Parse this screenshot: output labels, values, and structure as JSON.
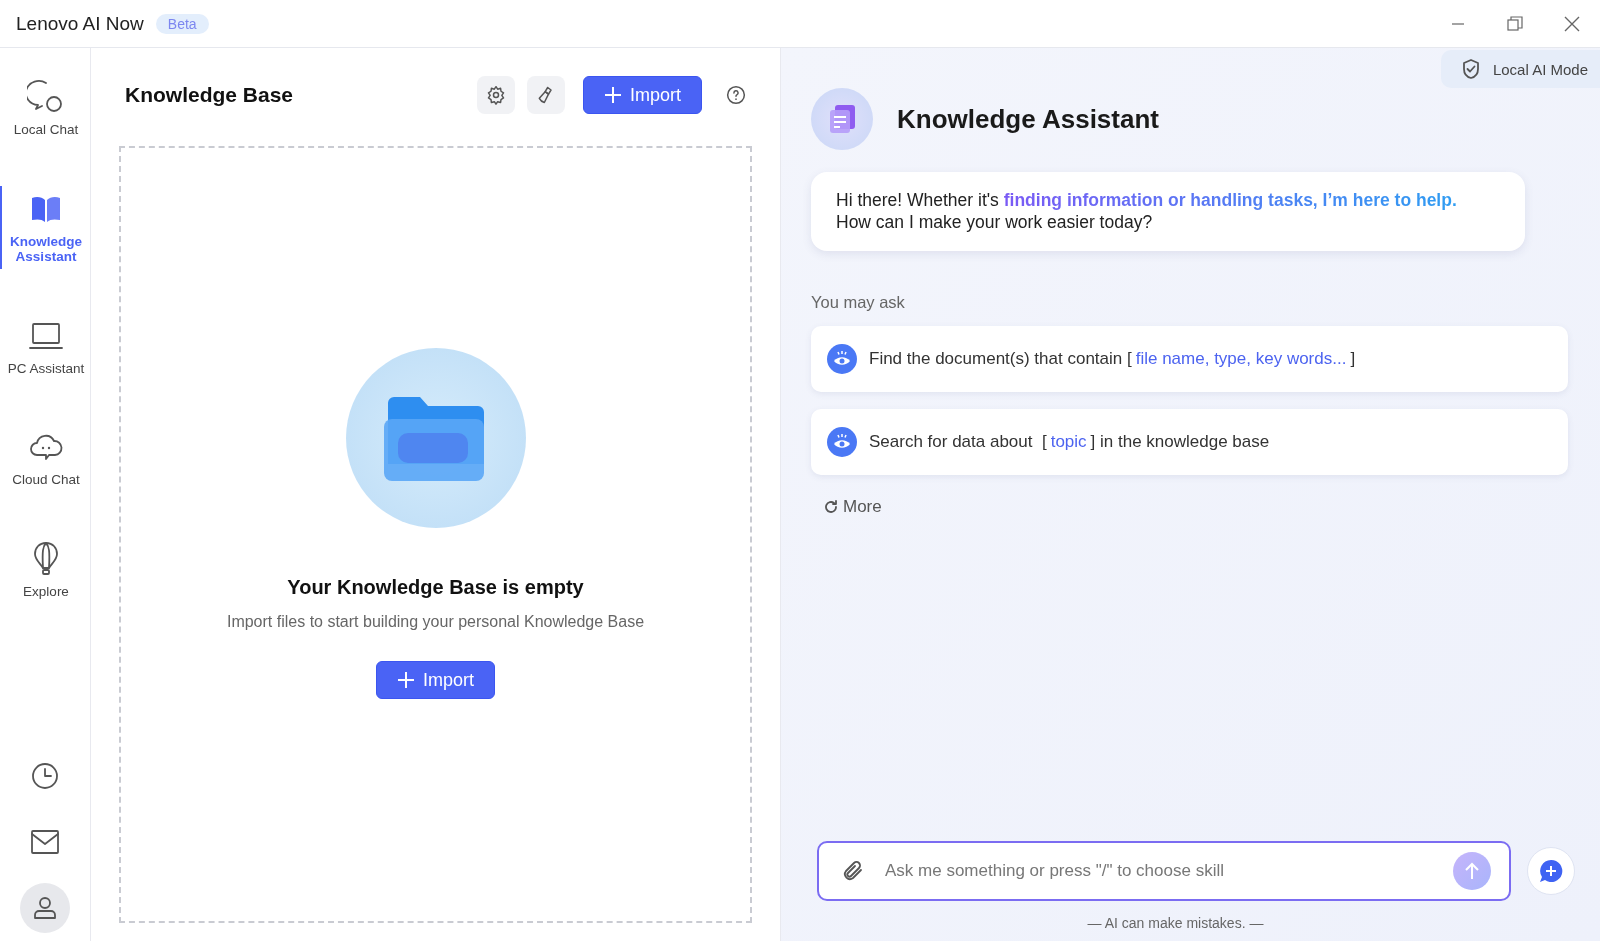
{
  "window": {
    "title": "Lenovo AI Now",
    "badge": "Beta"
  },
  "sidebar": {
    "items": [
      {
        "label": "Local Chat",
        "selected": false
      },
      {
        "label": "Knowledge Assistant",
        "selected": true
      },
      {
        "label": "PC Assistant",
        "selected": false
      },
      {
        "label": "Cloud Chat",
        "selected": false
      },
      {
        "label": "Explore",
        "selected": false
      }
    ]
  },
  "knowledge_base": {
    "title": "Knowledge Base",
    "import_button": "Import",
    "empty_title": "Your Knowledge Base is empty",
    "empty_text": "Import files to start building your personal Knowledge Base",
    "empty_import_button": "Import"
  },
  "assistant": {
    "mode": "Local AI Mode",
    "title": "Knowledge Assistant",
    "greeting": "Hi there! Whether it's **finding information or handling tasks, I’m here to help.**",
    "greeting_line_2": "How can I make your work easier today?",
    "suggestions_label": "You may ask",
    "suggestions": [
      {
        "parts": [
          {
            "text": "Find the document(s) that contain [",
            "highlight": false
          },
          {
            "text": "file name, type, key words...",
            "highlight": true
          },
          {
            "text": "]",
            "highlight": false
          }
        ]
      },
      {
        "parts": [
          {
            "text": "Search for data about  [",
            "highlight": false
          },
          {
            "text": "topic",
            "highlight": true
          },
          {
            "text": "] in the knowledge base",
            "highlight": false
          }
        ]
      }
    ],
    "more": "More",
    "input": {
      "placeholder": "Ask me something or press \"/\" to choose skill"
    },
    "disclaimer": "— AI can make mistakes. —"
  }
}
